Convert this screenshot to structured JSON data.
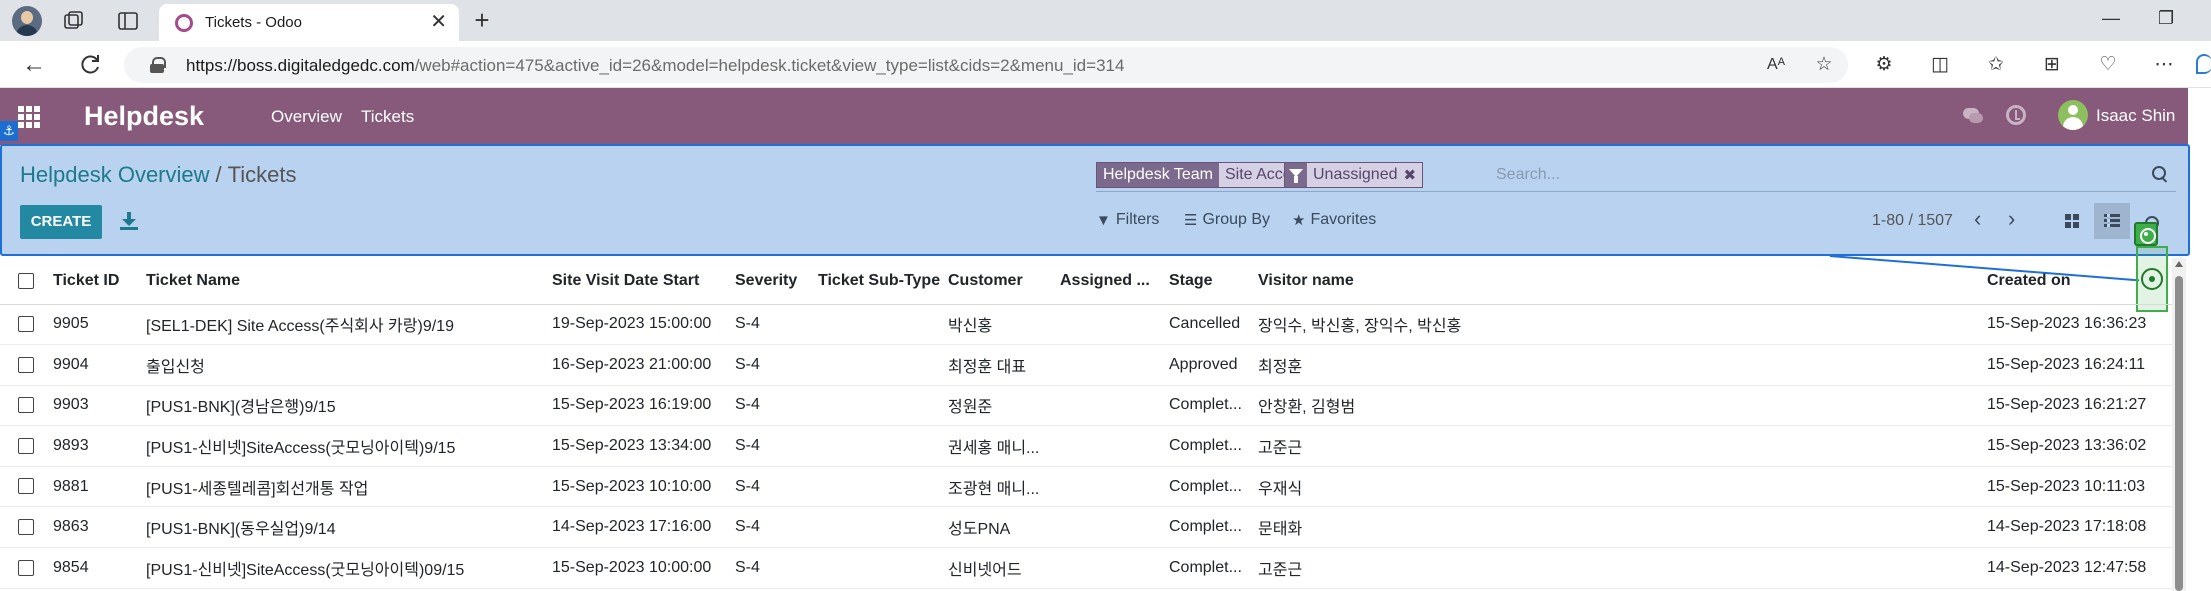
{
  "browser": {
    "tab_title": "Tickets - Odoo",
    "url_host": "https://boss.digitaledgedc.com",
    "url_path": "/web#action=475&active_id=26&model=helpdesk.ticket&view_type=list&cids=2&menu_id=314"
  },
  "navbar": {
    "brand": "Helpdesk",
    "menu": [
      "Overview",
      "Tickets"
    ],
    "user_name": "Isaac Shin",
    "color": "#875a7b"
  },
  "control_panel": {
    "breadcrumb_parent": "Helpdesk Overview",
    "breadcrumb_separator": "/",
    "breadcrumb_current": "Tickets",
    "create_label": "CREATE",
    "facets": [
      {
        "label": "Helpdesk Team",
        "value": "Site Access KR"
      },
      {
        "label": "filter-icon",
        "value": "Unassigned"
      }
    ],
    "search_placeholder": "Search...",
    "filters_label": "Filters",
    "group_by_label": "Group By",
    "favorites_label": "Favorites",
    "pager": "1-80 / 1507",
    "highlight_color": "#b8d2f0"
  },
  "table": {
    "headers": [
      "Ticket ID",
      "Ticket Name",
      "Site Visit Date Start",
      "Severity",
      "Ticket Sub-Type",
      "Customer",
      "Assigned ...",
      "Stage",
      "Visitor name",
      "Created on"
    ],
    "rows": [
      {
        "id": "9905",
        "name": "[SEL1-DEK] Site Access(주식회사 카랑)9/19",
        "visit": "19-Sep-2023 15:00:00",
        "severity": "S-4",
        "subtype": "",
        "customer": "박신홍",
        "assigned": "",
        "stage": "Cancelled",
        "visitor": "장익수, 박신홍, 장익수, 박신홍",
        "created": "15-Sep-2023 16:36:23"
      },
      {
        "id": "9904",
        "name": "출입신청",
        "visit": "16-Sep-2023 21:00:00",
        "severity": "S-4",
        "subtype": "",
        "customer": "최정훈 대표",
        "assigned": "",
        "stage": "Approved",
        "visitor": "최정훈",
        "created": "15-Sep-2023 16:24:11"
      },
      {
        "id": "9903",
        "name": "[PUS1-BNK](경남은행)9/15",
        "visit": "15-Sep-2023 16:19:00",
        "severity": "S-4",
        "subtype": "",
        "customer": "정원준",
        "assigned": "",
        "stage": "Complet...",
        "visitor": "안창환, 김형범",
        "created": "15-Sep-2023 16:21:27"
      },
      {
        "id": "9893",
        "name": "[PUS1-신비넷]SiteAccess(굿모닝아이텍)9/15",
        "visit": "15-Sep-2023 13:34:00",
        "severity": "S-4",
        "subtype": "",
        "customer": "권세홍 매니...",
        "assigned": "",
        "stage": "Complet...",
        "visitor": "고준근",
        "created": "15-Sep-2023 13:36:02"
      },
      {
        "id": "9881",
        "name": "[PUS1-세종텔레콤]회선개통 작업",
        "visit": "15-Sep-2023 10:10:00",
        "severity": "S-4",
        "subtype": "",
        "customer": "조광현 매니...",
        "assigned": "",
        "stage": "Complet...",
        "visitor": "우재식",
        "created": "15-Sep-2023 10:11:03"
      },
      {
        "id": "9863",
        "name": "[PUS1-BNK](동우실업)9/14",
        "visit": "14-Sep-2023 17:16:00",
        "severity": "S-4",
        "subtype": "",
        "customer": "성도PNA",
        "assigned": "",
        "stage": "Complet...",
        "visitor": "문태화",
        "created": "14-Sep-2023 17:18:08"
      },
      {
        "id": "9854",
        "name": "[PUS1-신비넷]SiteAccess(굿모닝아이텍)09/15",
        "visit": "15-Sep-2023 10:00:00",
        "severity": "S-4",
        "subtype": "",
        "customer": "신비넷어드",
        "assigned": "",
        "stage": "Complet...",
        "visitor": "고준근",
        "created": "14-Sep-2023 12:47:58"
      }
    ]
  }
}
